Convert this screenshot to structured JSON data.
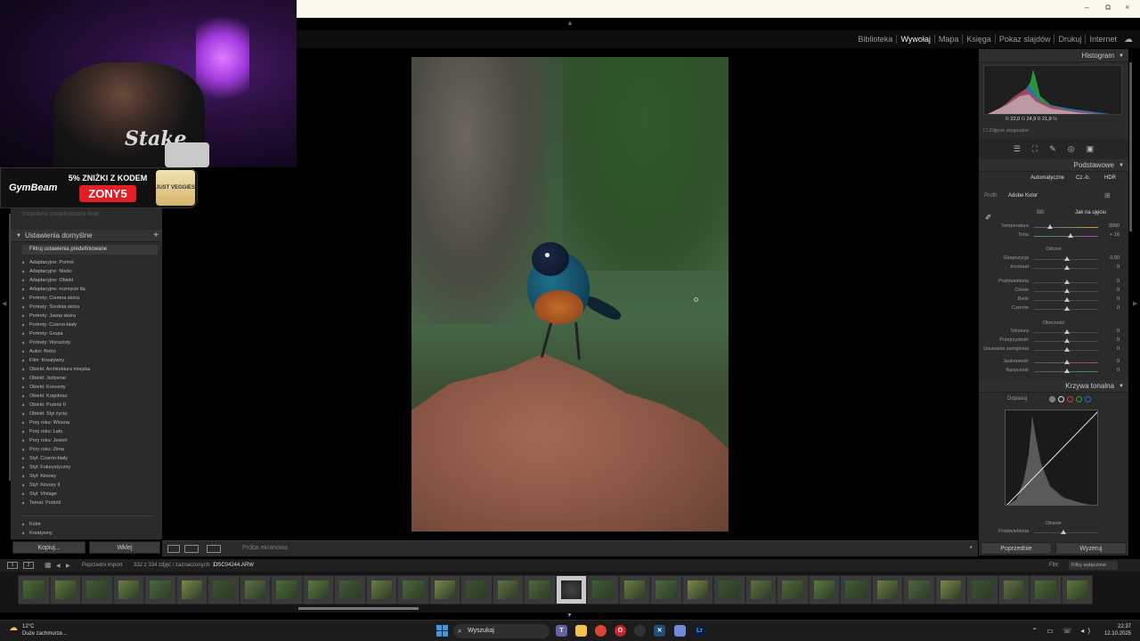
{
  "webcam": {
    "shirt_text": "Stake"
  },
  "ad": {
    "brand": "GymBeam",
    "promo_top": "5% ZNIŻKI Z KODEM",
    "promo_code": "ZONY5",
    "product": "JUST VEGGIES"
  },
  "window": {
    "min": "–",
    "max": "⧉",
    "close": "×"
  },
  "modules": [
    "Biblioteka",
    "Wywołaj",
    "Mapa",
    "Księga",
    "Pokaz slajdów",
    "Drukuj",
    "Internet"
  ],
  "modules_active": "Wywołaj",
  "left_panel": {
    "faded": "Ustawienia predefiniowane     Brak",
    "section_title": "Ustawienia domyślne",
    "filter_label": "Filtruj ustawienia predefiniowane",
    "presets": [
      "Adaptacyjne: Portret",
      "Adaptacyjne: Niebo",
      "Adaptacyjne: Obiekt",
      "Adaptacyjne: rozmycie tła",
      "Portrety: Ciemna skóra",
      "Portrety: Średnia skóra",
      "Portrety: Jasna skóra",
      "Portrety: Czarno-biały",
      "Portrety: Grupa",
      "Portrety: Wyrazisty",
      "Autor: Retro",
      "Film: Kreatywny",
      "Obiekt: Architektura miejska",
      "Obiekt: Jedzenie",
      "Obiekt: Koncerty",
      "Obiekt: Krajobraz",
      "Obiekt: Podróż II",
      "Obiekt: Styl życia",
      "Pory roku: Wiosna",
      "Pory roku: Lato",
      "Pory roku: Jesień",
      "Pory roku: Zima",
      "Styl: Czarno-biały",
      "Styl: Futurystyczny",
      "Styl: Kinowy",
      "Styl: Kinowy II",
      "Styl: Vintage",
      "Temat: Podróż"
    ],
    "presets_extra": [
      "Kolor",
      "Kreatywny"
    ],
    "copy_btn": "Kopiuj...",
    "paste_btn": "Wklej"
  },
  "toolbar": {
    "label": "Próba ekranowa",
    "dropdown": "▾"
  },
  "right_panel": {
    "histogram_title": "Histogram",
    "histo_r_label": "R",
    "histo_r": "22,0",
    "histo_g_label": "G",
    "histo_g": "24,9",
    "histo_b_label": "B",
    "histo_b": "21,9",
    "histo_unit": "%",
    "original_photo": "Zdjęcie oryginalne",
    "basic_title": "Podstawowe",
    "auto_btn": "Automatyczne",
    "bw_btn": "Cz.-b.",
    "hdr_btn": "HDR",
    "profile_label": "Profil:",
    "profile_value": "Adobe Kolor",
    "wb_label": "BB:",
    "wb_value": "Jak na ujęciu",
    "temp_label": "Temperatura",
    "temp_value": "3950",
    "tint_label": "Tinta",
    "tint_value": "+ 16",
    "tone_header": "Odcień",
    "exposure_label": "Ekspozycja",
    "exposure_value": "0,00",
    "contrast_label": "Kontrast",
    "contrast_value": "0",
    "highlights_label": "Podświetlenia",
    "highlights_value": "0",
    "shadows_label": "Cienie",
    "shadows_value": "0",
    "whites_label": "Biele",
    "whites_value": "0",
    "blacks_label": "Czernie",
    "blacks_value": "0",
    "presence_header": "Obecność",
    "texture_label": "Tekstura",
    "texture_value": "0",
    "clarity_label": "Przejrzystość",
    "clarity_value": "0",
    "dehaze_label": "Usuwanie zamglenia",
    "dehaze_value": "0",
    "vibrance_label": "Jaskrawość",
    "vibrance_value": "0",
    "saturation_label": "Nasycenie",
    "saturation_value": "0",
    "curve_title": "Krzywa tonalna",
    "curve_adjust": "Dopasuj",
    "region_label": "Obszar",
    "curve_highlights": "Podświetlenia",
    "prev_btn": "Poprzednie",
    "reset_btn": "Wyzeruj"
  },
  "filmstrip_bar": {
    "view1": "1",
    "view2": "2",
    "source": "Poprzedni import",
    "count": "332 z 334 zdjęć / zaznaczonych: 1 /",
    "filename": "DSC04244.ARW",
    "filter_label": "Filtr:",
    "filter_value": "Filtry wyłączone"
  },
  "taskbar": {
    "temp": "12°C",
    "weather": "Duże zachmurze...",
    "search": "Wyszukaj",
    "time": "22:37",
    "date": "12.10.2025"
  }
}
